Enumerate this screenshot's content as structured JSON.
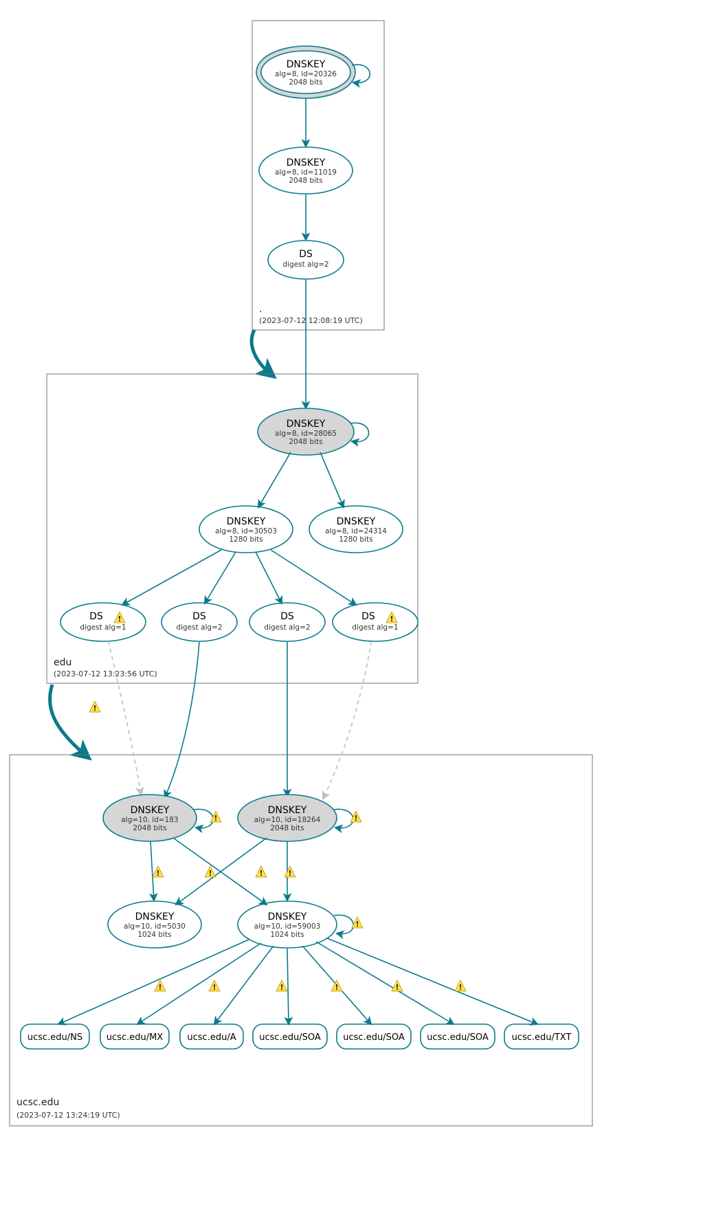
{
  "colors": {
    "teal": "#0a7a8c",
    "zone_border": "#737373",
    "node_fill_gray": "#d6d6d6",
    "warn_fill": "#ffe14d",
    "warn_stroke": "#b88a00",
    "dashed_gray": "#bfbfbf"
  },
  "zones": {
    "root": {
      "label": ".",
      "timestamp": "(2023-07-12 12:08:19 UTC)"
    },
    "edu": {
      "label": "edu",
      "timestamp": "(2023-07-12 13:23:56 UTC)"
    },
    "ucsc": {
      "label": "ucsc.edu",
      "timestamp": "(2023-07-12 13:24:19 UTC)"
    }
  },
  "nodes": {
    "root_ksk": {
      "title": "DNSKEY",
      "line2": "alg=8, id=20326",
      "line3": "2048 bits"
    },
    "root_zsk": {
      "title": "DNSKEY",
      "line2": "alg=8, id=11019",
      "line3": "2048 bits"
    },
    "root_ds": {
      "title": "DS",
      "line2": "digest alg=2",
      "line3": ""
    },
    "edu_ksk": {
      "title": "DNSKEY",
      "line2": "alg=8, id=28065",
      "line3": "2048 bits"
    },
    "edu_zsk1": {
      "title": "DNSKEY",
      "line2": "alg=8, id=30503",
      "line3": "1280 bits"
    },
    "edu_zsk2": {
      "title": "DNSKEY",
      "line2": "alg=8, id=24314",
      "line3": "1280 bits"
    },
    "edu_ds1": {
      "title": "DS",
      "line2": "digest alg=1",
      "line3": ""
    },
    "edu_ds2": {
      "title": "DS",
      "line2": "digest alg=2",
      "line3": ""
    },
    "edu_ds3": {
      "title": "DS",
      "line2": "digest alg=2",
      "line3": ""
    },
    "edu_ds4": {
      "title": "DS",
      "line2": "digest alg=1",
      "line3": ""
    },
    "uc_ksk1": {
      "title": "DNSKEY",
      "line2": "alg=10, id=183",
      "line3": "2048 bits"
    },
    "uc_ksk2": {
      "title": "DNSKEY",
      "line2": "alg=10, id=18264",
      "line3": "2048 bits"
    },
    "uc_zsk1": {
      "title": "DNSKEY",
      "line2": "alg=10, id=5030",
      "line3": "1024 bits"
    },
    "uc_zsk2": {
      "title": "DNSKEY",
      "line2": "alg=10, id=59003",
      "line3": "1024 bits"
    }
  },
  "records": {
    "r1": "ucsc.edu/NS",
    "r2": "ucsc.edu/MX",
    "r3": "ucsc.edu/A",
    "r4": "ucsc.edu/SOA",
    "r5": "ucsc.edu/SOA",
    "r6": "ucsc.edu/SOA",
    "r7": "ucsc.edu/TXT"
  },
  "ds_label": "DS"
}
